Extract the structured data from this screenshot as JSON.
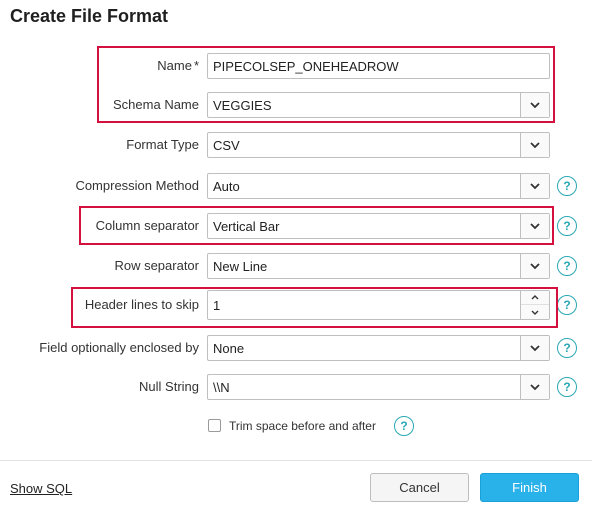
{
  "dialog": {
    "title": "Create File Format"
  },
  "fields": [
    {
      "label": "Name",
      "required_mark": "*",
      "value": "PIPECOLSEP_ONEHEADROW",
      "control": "text",
      "help": false
    },
    {
      "label": "Schema Name",
      "value": "VEGGIES",
      "control": "select",
      "help": false
    },
    {
      "label": "Format Type",
      "value": "CSV",
      "control": "select",
      "help": false
    },
    {
      "label": "Compression Method",
      "value": "Auto",
      "control": "select",
      "help": true
    },
    {
      "label": "Column separator",
      "value": "Vertical Bar",
      "control": "select",
      "help": true
    },
    {
      "label": "Row separator",
      "value": "New Line",
      "control": "select",
      "help": true
    },
    {
      "label": "Header lines to skip",
      "value": "1",
      "control": "number",
      "help": true
    },
    {
      "label": "Field optionally enclosed by",
      "value": "None",
      "control": "select",
      "help": true
    },
    {
      "label": "Null String",
      "value": "\\\\N",
      "control": "select",
      "help": true
    }
  ],
  "checkbox": {
    "label": "Trim space before and after",
    "checked": false
  },
  "help_glyph": "?",
  "footer": {
    "show_sql": "Show SQL",
    "cancel": "Cancel",
    "finish": "Finish"
  },
  "colors": {
    "highlight": "#d4113e",
    "accent": "#29b1ea",
    "help": "#2aa8b4"
  }
}
